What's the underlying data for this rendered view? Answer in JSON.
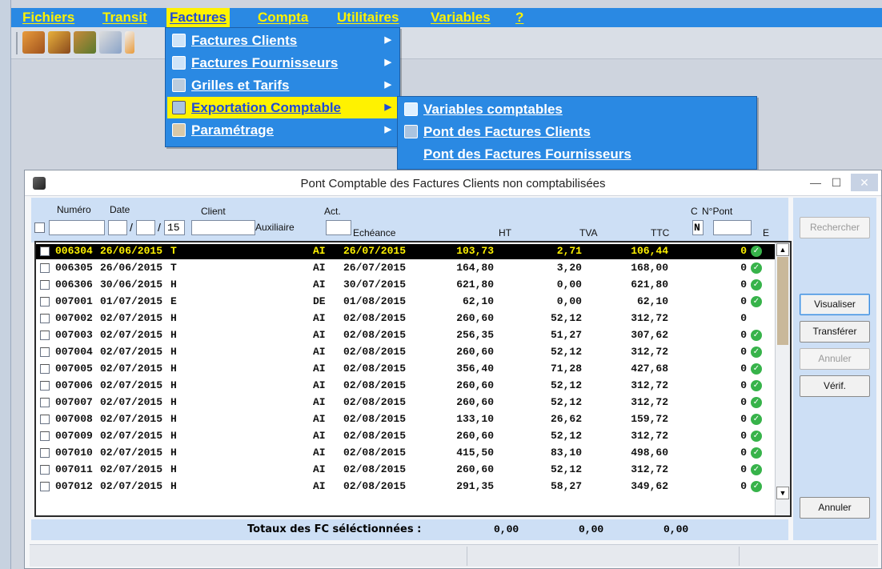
{
  "menubar": {
    "items": [
      "Fichiers",
      "Transit",
      "Factures",
      "Compta",
      "Utilitaires",
      "Variables",
      "?"
    ]
  },
  "factures_menu": {
    "items": [
      {
        "label": "Factures Clients"
      },
      {
        "label": "Factures Fournisseurs"
      },
      {
        "label": "Grilles et Tarifs"
      },
      {
        "label": "Exportation Comptable"
      },
      {
        "label": "Paramétrage"
      }
    ]
  },
  "export_submenu": {
    "items": [
      {
        "label": "Variables comptables"
      },
      {
        "label": "Pont des Factures Clients"
      },
      {
        "label": "Pont des Factures Fournisseurs"
      }
    ]
  },
  "dialog": {
    "title": "Pont Comptable des Factures Clients non comptabilisées",
    "filters": {
      "numero_label": "Numéro",
      "date_label": "Date",
      "client_label": "Client",
      "auxiliaire_label": "Auxiliaire",
      "act_label": "Act.",
      "echeance_label": "Echéance",
      "ht_label": "HT",
      "tva_label": "TVA",
      "ttc_label": "TTC",
      "c_label": "C",
      "npont_label": "N°Pont",
      "e_label": "E",
      "date_year_value": "15",
      "c_value": "N"
    },
    "rows": [
      {
        "num": "006304",
        "date": "26/06/2015",
        "t": "T",
        "act": "AI",
        "ech": "26/07/2015",
        "ht": "103,73",
        "tva": "2,71",
        "ttc": "106,44",
        "pont": "0",
        "status": true
      },
      {
        "num": "006305",
        "date": "26/06/2015",
        "t": "T",
        "act": "AI",
        "ech": "26/07/2015",
        "ht": "164,80",
        "tva": "3,20",
        "ttc": "168,00",
        "pont": "0",
        "status": true
      },
      {
        "num": "006306",
        "date": "30/06/2015",
        "t": "H",
        "act": "AI",
        "ech": "30/07/2015",
        "ht": "621,80",
        "tva": "0,00",
        "ttc": "621,80",
        "pont": "0",
        "status": true
      },
      {
        "num": "007001",
        "date": "01/07/2015",
        "t": "E",
        "act": "DE",
        "ech": "01/08/2015",
        "ht": "62,10",
        "tva": "0,00",
        "ttc": "62,10",
        "pont": "0",
        "status": true
      },
      {
        "num": "007002",
        "date": "02/07/2015",
        "t": "H",
        "act": "AI",
        "ech": "02/08/2015",
        "ht": "260,60",
        "tva": "52,12",
        "ttc": "312,72",
        "pont": "0",
        "status": false
      },
      {
        "num": "007003",
        "date": "02/07/2015",
        "t": "H",
        "act": "AI",
        "ech": "02/08/2015",
        "ht": "256,35",
        "tva": "51,27",
        "ttc": "307,62",
        "pont": "0",
        "status": true
      },
      {
        "num": "007004",
        "date": "02/07/2015",
        "t": "H",
        "act": "AI",
        "ech": "02/08/2015",
        "ht": "260,60",
        "tva": "52,12",
        "ttc": "312,72",
        "pont": "0",
        "status": true
      },
      {
        "num": "007005",
        "date": "02/07/2015",
        "t": "H",
        "act": "AI",
        "ech": "02/08/2015",
        "ht": "356,40",
        "tva": "71,28",
        "ttc": "427,68",
        "pont": "0",
        "status": true
      },
      {
        "num": "007006",
        "date": "02/07/2015",
        "t": "H",
        "act": "AI",
        "ech": "02/08/2015",
        "ht": "260,60",
        "tva": "52,12",
        "ttc": "312,72",
        "pont": "0",
        "status": true
      },
      {
        "num": "007007",
        "date": "02/07/2015",
        "t": "H",
        "act": "AI",
        "ech": "02/08/2015",
        "ht": "260,60",
        "tva": "52,12",
        "ttc": "312,72",
        "pont": "0",
        "status": true
      },
      {
        "num": "007008",
        "date": "02/07/2015",
        "t": "H",
        "act": "AI",
        "ech": "02/08/2015",
        "ht": "133,10",
        "tva": "26,62",
        "ttc": "159,72",
        "pont": "0",
        "status": true
      },
      {
        "num": "007009",
        "date": "02/07/2015",
        "t": "H",
        "act": "AI",
        "ech": "02/08/2015",
        "ht": "260,60",
        "tva": "52,12",
        "ttc": "312,72",
        "pont": "0",
        "status": true
      },
      {
        "num": "007010",
        "date": "02/07/2015",
        "t": "H",
        "act": "AI",
        "ech": "02/08/2015",
        "ht": "415,50",
        "tva": "83,10",
        "ttc": "498,60",
        "pont": "0",
        "status": true
      },
      {
        "num": "007011",
        "date": "02/07/2015",
        "t": "H",
        "act": "AI",
        "ech": "02/08/2015",
        "ht": "260,60",
        "tva": "52,12",
        "ttc": "312,72",
        "pont": "0",
        "status": true
      },
      {
        "num": "007012",
        "date": "02/07/2015",
        "t": "H",
        "act": "AI",
        "ech": "02/08/2015",
        "ht": "291,35",
        "tva": "58,27",
        "ttc": "349,62",
        "pont": "0",
        "status": true
      }
    ],
    "totals": {
      "label": "Totaux des FC séléctionnées :",
      "ht": "0,00",
      "tva": "0,00",
      "ttc": "0,00"
    },
    "buttons": {
      "rechercher": "Rechercher",
      "visualiser": "Visualiser",
      "transferer": "Transférer",
      "annuler_disabled": "Annuler",
      "verif": "Vérif.",
      "annuler": "Annuler"
    }
  },
  "colors": {
    "menu_blue": "#2a89e3",
    "highlight_yellow": "#fff200",
    "filter_bg": "#cddff5",
    "status_green": "#37b34a"
  },
  "icons": [
    "toolbar-tool-icons",
    "check-circle-icon",
    "scroll-up-icon",
    "scroll-down-icon",
    "submenu-arrow-icon",
    "minimize-icon",
    "maximize-icon",
    "close-icon",
    "app-icon"
  ]
}
